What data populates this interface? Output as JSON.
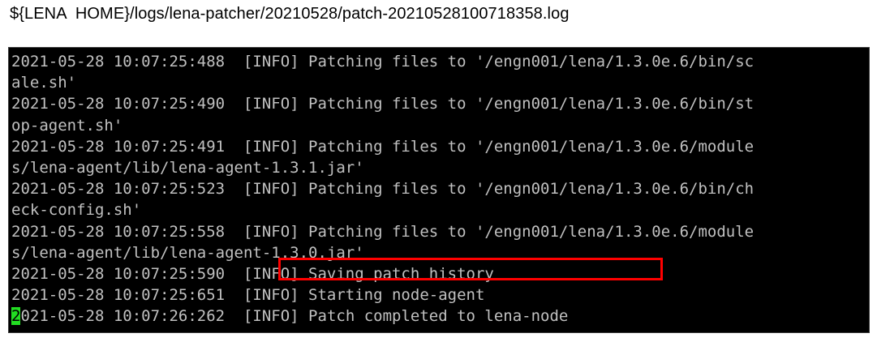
{
  "caption": "${LENA  HOME}/logs/lena-patcher/20210528/patch-20210528100718358.log",
  "terminal": {
    "background": "#000000",
    "text_color": "#c0c0c0",
    "cursor_color": "#22dd22",
    "highlight_color": "#ff0000",
    "lines": [
      "2021-05-28 10:07:25:488  [INFO] Patching files to '/engn001/lena/1.3.0e.6/bin/sc",
      "ale.sh'",
      "2021-05-28 10:07:25:490  [INFO] Patching files to '/engn001/lena/1.3.0e.6/bin/st",
      "op-agent.sh'",
      "2021-05-28 10:07:25:491  [INFO] Patching files to '/engn001/lena/1.3.0e.6/module",
      "s/lena-agent/lib/lena-agent-1.3.1.jar'",
      "2021-05-28 10:07:25:523  [INFO] Patching files to '/engn001/lena/1.3.0e.6/bin/ch",
      "eck-config.sh'",
      "2021-05-28 10:07:25:558  [INFO] Patching files to '/engn001/lena/1.3.0e.6/module",
      "s/lena-agent/lib/lena-agent-1.3.0.jar'",
      "2021-05-28 10:07:25:590  [INFO] Saving patch history",
      "2021-05-28 10:07:25:651  [INFO] Starting node-agent"
    ],
    "last_line": {
      "cursor_char": "2",
      "rest": "021-05-28 10:07:26:262  [INFO] Patch completed to lena-node"
    }
  }
}
